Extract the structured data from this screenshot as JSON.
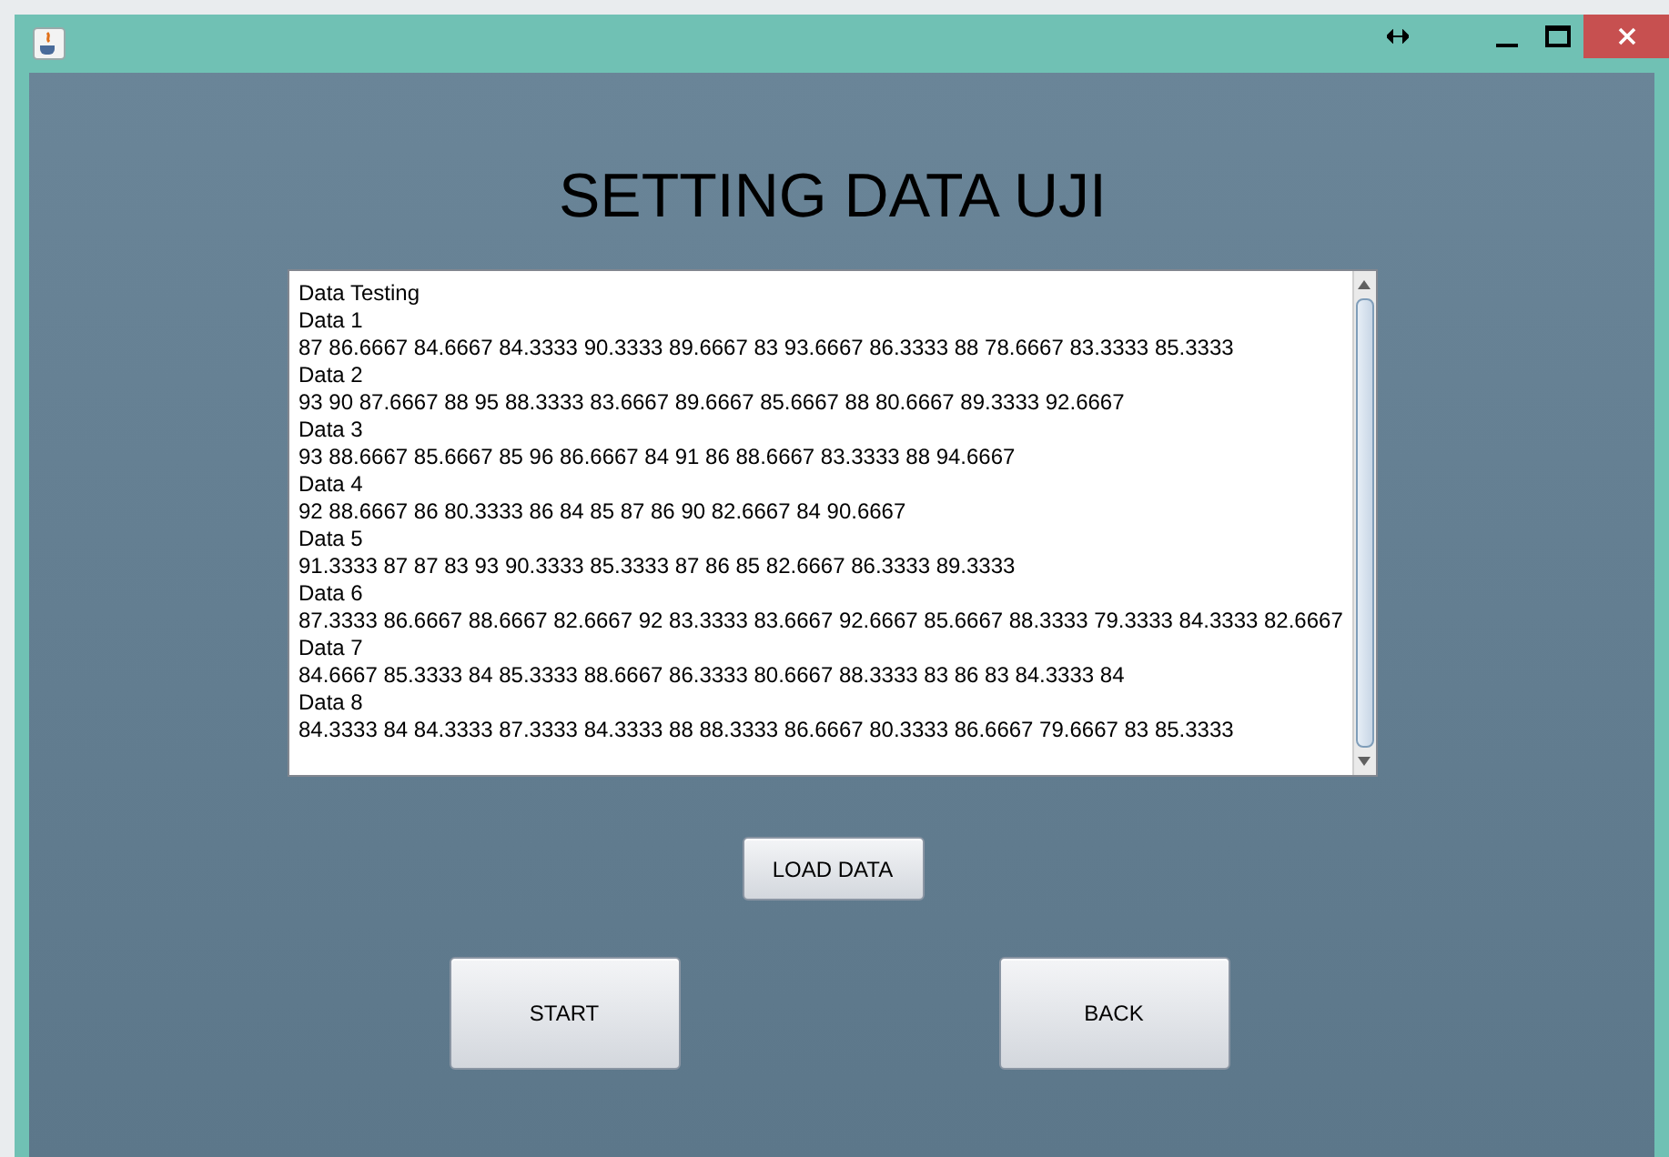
{
  "heading": "SETTING DATA UJI",
  "text_area": {
    "lines": [
      "Data Testing",
      "Data 1",
      "87 86.6667 84.6667 84.3333 90.3333 89.6667 83 93.6667 86.3333 88 78.6667 83.3333 85.3333",
      "Data 2",
      "93 90 87.6667 88 95 88.3333 83.6667 89.6667 85.6667 88 80.6667 89.3333 92.6667",
      "Data 3",
      "93 88.6667 85.6667 85 96 86.6667 84 91 86 88.6667 83.3333 88 94.6667",
      "Data 4",
      "92 88.6667 86 80.3333 86 84 85 87 86 90 82.6667 84 90.6667",
      "Data 5",
      "91.3333 87 87 83 93 90.3333 85.3333 87 86 85 82.6667 86.3333 89.3333",
      "Data 6",
      "87.3333 86.6667 88.6667 82.6667 92 83.3333 83.6667 92.6667 85.6667 88.3333 79.3333 84.3333 82.6667",
      "Data 7",
      "84.6667 85.3333 84 85.3333 88.6667 86.3333 80.6667 88.3333 83 86 83 84.3333 84",
      "Data 8",
      "84.3333 84 84.3333 87.3333 84.3333 88 88.3333 86.6667 80.3333 86.6667 79.6667 83 85.3333"
    ]
  },
  "load_button": "LOAD DATA",
  "buttons": [
    "START",
    "BACK"
  ]
}
